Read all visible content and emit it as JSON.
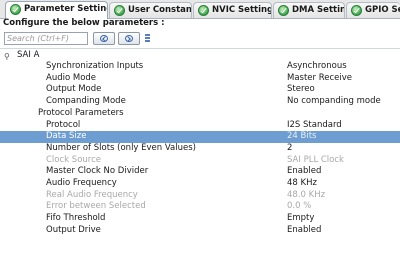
{
  "tabs": [
    {
      "label": "Parameter Settings",
      "active": true
    },
    {
      "label": "User Constants",
      "active": false
    },
    {
      "label": "NVIC Settings",
      "active": false
    },
    {
      "label": "DMA Settings",
      "active": false
    },
    {
      "label": "GPIO Sett",
      "active": false
    }
  ],
  "header": {
    "configure_label": "Configure the below parameters :"
  },
  "search": {
    "placeholder": "Search (Ctrl+F)"
  },
  "tree": {
    "group_label": "SAI A",
    "rows": [
      {
        "label": "Synchronization Inputs",
        "value": "Asynchronous"
      },
      {
        "label": "Audio Mode",
        "value": "Master Receive"
      },
      {
        "label": "Output Mode",
        "value": "Stereo"
      },
      {
        "label": "Companding Mode",
        "value": "No companding mode"
      },
      {
        "label": "Protocol Parameters",
        "value": ""
      },
      {
        "label": "Protocol",
        "value": "I2S Standard"
      },
      {
        "label": "Data Size",
        "value": "24 Bits"
      },
      {
        "label": "Number of Slots (only Even Values)",
        "value": "2"
      },
      {
        "label": "Clock Source",
        "value": "SAI PLL Clock"
      },
      {
        "label": "Master Clock No Divider",
        "value": "Enabled"
      },
      {
        "label": "Audio Frequency",
        "value": "48 KHz"
      },
      {
        "label": "Real Audio Frequency",
        "value": "48.0 KHz"
      },
      {
        "label": "Error between Selected",
        "value": "0.0 %"
      },
      {
        "label": "Fifo Threshold",
        "value": "Empty"
      },
      {
        "label": "Output Drive",
        "value": "Enabled"
      }
    ]
  },
  "colors": {
    "selection": "#6e9ed1",
    "disabled_text": "#a8a8a8",
    "tab_check": "#3aa64a"
  }
}
